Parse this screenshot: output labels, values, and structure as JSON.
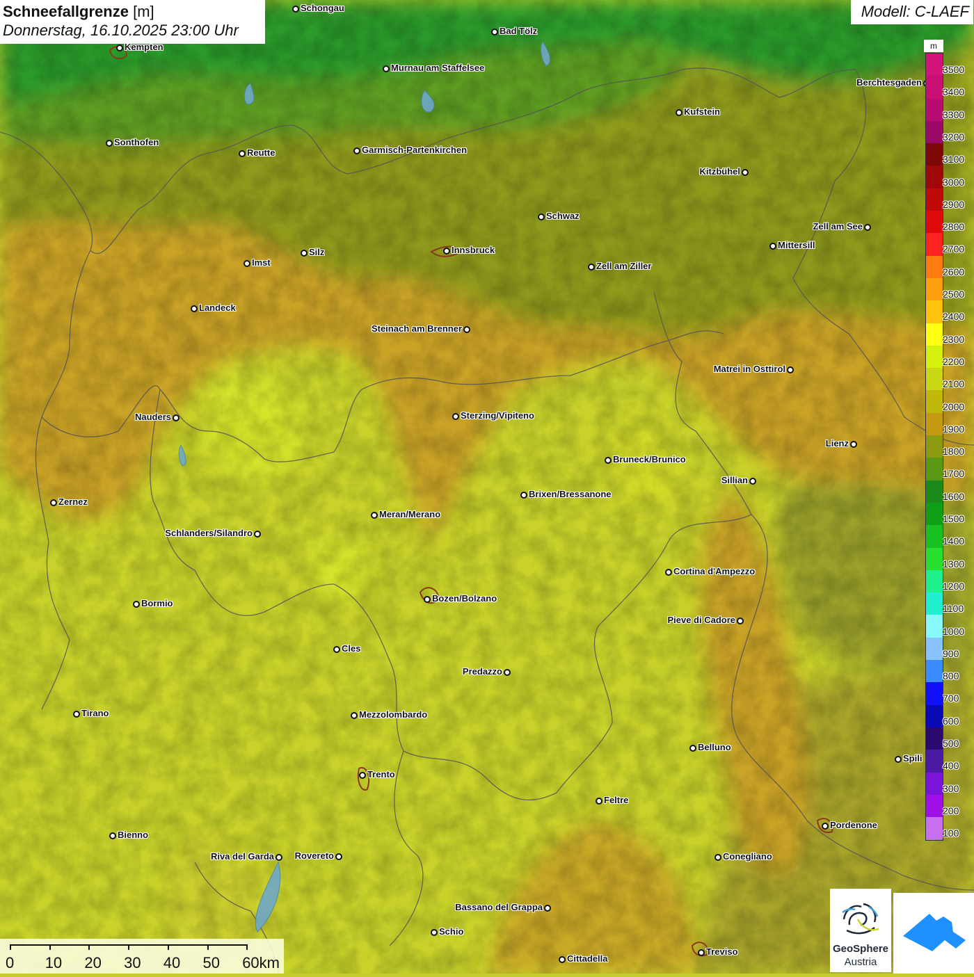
{
  "title": {
    "parameter": "Schneefallgrenze",
    "unit": "[m]",
    "datetime": "Donnerstag, 16.10.2025 23:00 Uhr"
  },
  "model_label": "Modell: C-LAEF",
  "legend": {
    "unit": "m",
    "items": [
      {
        "value": "3500",
        "color": "#d1137a"
      },
      {
        "value": "3400",
        "color": "#c90e74"
      },
      {
        "value": "3300",
        "color": "#b80c70"
      },
      {
        "value": "3200",
        "color": "#9c0a68"
      },
      {
        "value": "3100",
        "color": "#7e0808"
      },
      {
        "value": "3000",
        "color": "#a00808"
      },
      {
        "value": "2900",
        "color": "#c00a0a"
      },
      {
        "value": "2800",
        "color": "#e00a0a"
      },
      {
        "value": "2700",
        "color": "#ff2222"
      },
      {
        "value": "2600",
        "color": "#ff7b12"
      },
      {
        "value": "2500",
        "color": "#ff9f10"
      },
      {
        "value": "2400",
        "color": "#ffc20e"
      },
      {
        "value": "2300",
        "color": "#ffff10"
      },
      {
        "value": "2200",
        "color": "#d4f20e"
      },
      {
        "value": "2100",
        "color": "#c8d814"
      },
      {
        "value": "2000",
        "color": "#c0b80a"
      },
      {
        "value": "1900",
        "color": "#c49a10"
      },
      {
        "value": "1800",
        "color": "#8c9a10"
      },
      {
        "value": "1700",
        "color": "#5a9a12"
      },
      {
        "value": "1600",
        "color": "#1a8a1a"
      },
      {
        "value": "1500",
        "color": "#10a018"
      },
      {
        "value": "1400",
        "color": "#18c020"
      },
      {
        "value": "1300",
        "color": "#28e030"
      },
      {
        "value": "1200",
        "color": "#1ef08c"
      },
      {
        "value": "1100",
        "color": "#20f0d0"
      },
      {
        "value": "1000",
        "color": "#8af8ff"
      },
      {
        "value": "900",
        "color": "#8ac4ff"
      },
      {
        "value": "800",
        "color": "#3a8cff"
      },
      {
        "value": "700",
        "color": "#1010ff"
      },
      {
        "value": "600",
        "color": "#0a0ab4"
      },
      {
        "value": "500",
        "color": "#2a0a6e"
      },
      {
        "value": "400",
        "color": "#4a1aa0"
      },
      {
        "value": "300",
        "color": "#7a14d8"
      },
      {
        "value": "200",
        "color": "#a010e8"
      },
      {
        "value": "100",
        "color": "#c870f0"
      }
    ]
  },
  "cities": [
    {
      "name": "Schongau",
      "side": "r"
    },
    {
      "name": "Bad Tölz",
      "side": "r"
    },
    {
      "name": "Kempten",
      "side": "r"
    },
    {
      "name": "Murnau am Staffelsee",
      "side": "r"
    },
    {
      "name": "Berchtesgaden",
      "side": "l"
    },
    {
      "name": "Kufstein",
      "side": "r"
    },
    {
      "name": "Sonthofen",
      "side": "r"
    },
    {
      "name": "Reutte",
      "side": "r"
    },
    {
      "name": "Garmisch-Partenkirchen",
      "side": "r"
    },
    {
      "name": "Kitzbühel",
      "side": "l"
    },
    {
      "name": "Schwaz",
      "side": "r"
    },
    {
      "name": "Zell am See",
      "side": "l"
    },
    {
      "name": "Mittersill",
      "side": "r"
    },
    {
      "name": "Innsbruck",
      "side": "r"
    },
    {
      "name": "Silz",
      "side": "r"
    },
    {
      "name": "Imst",
      "side": "r"
    },
    {
      "name": "Zell am Ziller",
      "side": "r"
    },
    {
      "name": "Landeck",
      "side": "r"
    },
    {
      "name": "Steinach am Brenner",
      "side": "l"
    },
    {
      "name": "Matrei in Osttirol",
      "side": "l"
    },
    {
      "name": "Nauders",
      "side": "l"
    },
    {
      "name": "Sterzing/Vipiteno",
      "side": "r"
    },
    {
      "name": "Lienz",
      "side": "l"
    },
    {
      "name": "Bruneck/Brunico",
      "side": "r"
    },
    {
      "name": "Sillian",
      "side": "l"
    },
    {
      "name": "Brixen/Bressanone",
      "side": "r"
    },
    {
      "name": "Zernez",
      "side": "r"
    },
    {
      "name": "Meran/Merano",
      "side": "r"
    },
    {
      "name": "Schlanders/Silandro",
      "side": "l"
    },
    {
      "name": "Cortina d'Ampezzo",
      "side": "r"
    },
    {
      "name": "Bozen/Bolzano",
      "side": "r"
    },
    {
      "name": "Bormio",
      "side": "r"
    },
    {
      "name": "Pieve di Cadore",
      "side": "l"
    },
    {
      "name": "Cles",
      "side": "r"
    },
    {
      "name": "Predazzo",
      "side": "l"
    },
    {
      "name": "Tirano",
      "side": "r"
    },
    {
      "name": "Mezzolombardo",
      "side": "r"
    },
    {
      "name": "Belluno",
      "side": "r"
    },
    {
      "name": "Spili",
      "side": "r"
    },
    {
      "name": "Trento",
      "side": "r"
    },
    {
      "name": "Feltre",
      "side": "r"
    },
    {
      "name": "Pordenone",
      "side": "r"
    },
    {
      "name": "Bienno",
      "side": "r"
    },
    {
      "name": "Riva del Garda",
      "side": "l"
    },
    {
      "name": "Rovereto",
      "side": "l"
    },
    {
      "name": "Conegliano",
      "side": "r"
    },
    {
      "name": "Bassano del Grappa",
      "side": "l"
    },
    {
      "name": "Schio",
      "side": "r"
    },
    {
      "name": "Treviso",
      "side": "r"
    },
    {
      "name": "Cittadella",
      "side": "r"
    }
  ],
  "scale_bar": {
    "labels": [
      "0",
      "10",
      "20",
      "30",
      "40",
      "50",
      "60km"
    ]
  },
  "logo": {
    "name": "GeoSphere",
    "sub": "Austria"
  }
}
